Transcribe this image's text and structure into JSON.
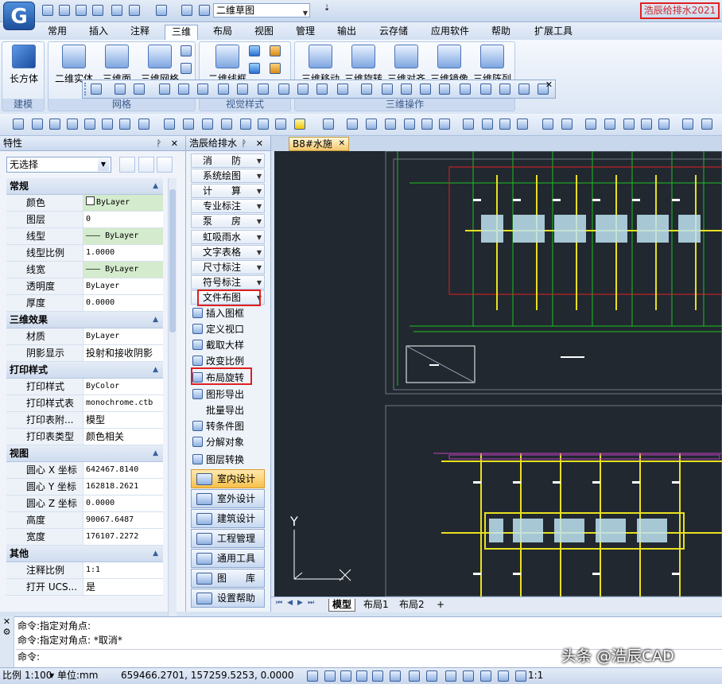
{
  "titlebar": {
    "drawing_name": "二维草图",
    "app_title": "浩辰给排水2021",
    "logo_letter": "G"
  },
  "menu": [
    "常用",
    "插入",
    "注释",
    "三维",
    "布局",
    "视图",
    "管理",
    "输出",
    "云存储",
    "应用软件",
    "帮助",
    "扩展工具"
  ],
  "active_menu": "三维",
  "ribbon": {
    "groups": [
      "建模",
      "网格",
      "视觉样式",
      "三维操作"
    ],
    "buttons": {
      "box": "长方体",
      "mesh_solid": "二维实体",
      "mesh_surface": "三维面",
      "mesh_grid": "三维网格",
      "wire": "二维线框",
      "move3d": "三维移动",
      "rotate3d": "三维旋转",
      "align3d": "三维对齐",
      "mirror3d": "三维镜像",
      "array3d": "三维阵列"
    }
  },
  "properties": {
    "title": "特性",
    "selection": "无选择",
    "sections": [
      {
        "name": "常规",
        "rows": [
          {
            "k": "颜色",
            "v": "ByLayer",
            "style": "green",
            "swatch": true
          },
          {
            "k": "图层",
            "v": "0"
          },
          {
            "k": "线型",
            "v": "——— ByLayer",
            "style": "green"
          },
          {
            "k": "线型比例",
            "v": "1.0000"
          },
          {
            "k": "线宽",
            "v": "——— ByLayer",
            "style": "green"
          },
          {
            "k": "透明度",
            "v": "ByLayer"
          },
          {
            "k": "厚度",
            "v": "0.0000"
          }
        ]
      },
      {
        "name": "三维效果",
        "rows": [
          {
            "k": "材质",
            "v": "ByLayer"
          },
          {
            "k": "阴影显示",
            "v": "投射和接收阴影",
            "style": "cn"
          }
        ]
      },
      {
        "name": "打印样式",
        "rows": [
          {
            "k": "打印样式",
            "v": "ByColor"
          },
          {
            "k": "打印样式表",
            "v": "monochrome.ctb"
          },
          {
            "k": "打印表附...",
            "v": "模型",
            "style": "cn"
          },
          {
            "k": "打印表类型",
            "v": "颜色相关",
            "style": "cn"
          }
        ]
      },
      {
        "name": "视图",
        "rows": [
          {
            "k": "圆心 X 坐标",
            "v": "642467.8140"
          },
          {
            "k": "圆心 Y 坐标",
            "v": "162818.2621"
          },
          {
            "k": "圆心 Z 坐标",
            "v": "0.0000"
          },
          {
            "k": "高度",
            "v": "90067.6487"
          },
          {
            "k": "宽度",
            "v": "176107.2272"
          }
        ]
      },
      {
        "name": "其他",
        "rows": [
          {
            "k": "注释比例",
            "v": "1:1"
          },
          {
            "k": "打开 UCS...",
            "v": "是",
            "style": "cn"
          }
        ]
      }
    ]
  },
  "toolpanel": {
    "title": "浩辰给排水",
    "menus": [
      "消　　防",
      "系统绘图",
      "计　　算",
      "专业标注",
      "泵　　房",
      "虹吸雨水",
      "文字表格",
      "尺寸标注",
      "符号标注",
      "文件布图"
    ],
    "items": [
      "插入图框",
      "定义视口",
      "截取大样",
      "改变比例",
      "布局旋转",
      "图形导出",
      "批量导出",
      "转条件图",
      "分解对象",
      "图层转换"
    ],
    "modules": [
      "室内设计",
      "室外设计",
      "建筑设计",
      "工程管理",
      "通用工具",
      "图　　库",
      "设置帮助"
    ]
  },
  "drawing": {
    "tab": "B8#水施",
    "axis_y": "Y",
    "axis_x": "X"
  },
  "layout_tabs": [
    "模型",
    "布局1",
    "布局2",
    "+"
  ],
  "command": {
    "lines": [
      "命令:指定对角点:",
      "命令:指定对角点: *取消*"
    ],
    "prompt": "命令:"
  },
  "status": {
    "scale": "比例 1:100",
    "unit": "单位:mm",
    "coords": "659466.2701, 157259.5253, 0.0000",
    "anno": "1:1"
  },
  "watermark": "头条 @浩辰CAD"
}
